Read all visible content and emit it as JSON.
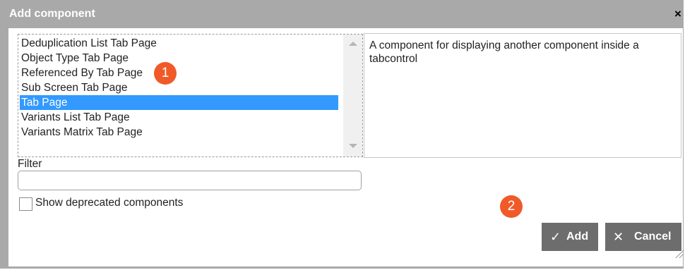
{
  "dialog": {
    "title": "Add component",
    "close_icon": "×"
  },
  "component_list": {
    "items": [
      "Deduplication List Tab Page",
      "Object Type Tab Page",
      "Referenced By Tab Page",
      "Sub Screen Tab Page",
      "Tab Page",
      "Variants List Tab Page",
      "Variants Matrix Tab Page"
    ],
    "selected_index": 4
  },
  "description": {
    "text": "A component for displaying another component inside a tabcontrol"
  },
  "filter": {
    "label": "Filter",
    "value": ""
  },
  "show_deprecated": {
    "label": "Show deprecated components",
    "checked": false
  },
  "annotations": {
    "step1": "1",
    "step2": "2"
  },
  "buttons": {
    "add_icon": "✓",
    "add_label": "Add",
    "cancel_icon": "✕",
    "cancel_label": "Cancel"
  },
  "colors": {
    "titlebar": "#a9a9a9",
    "selection": "#3399ff",
    "button": "#6d6d6d",
    "badge": "#f05a28"
  }
}
